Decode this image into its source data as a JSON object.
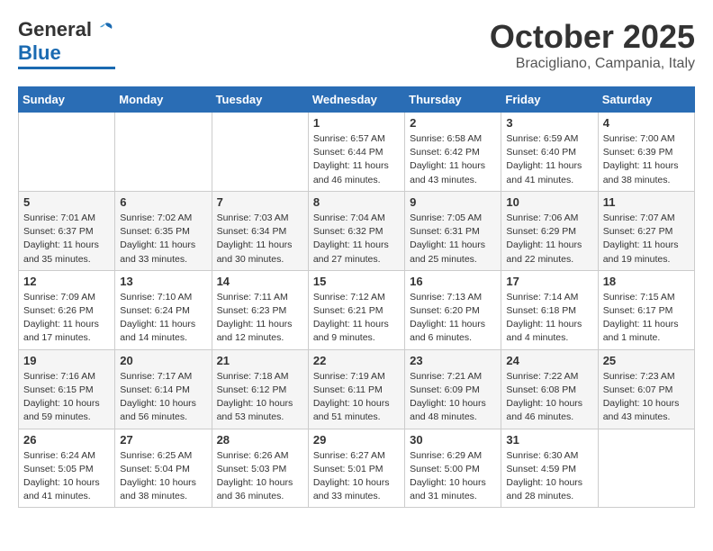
{
  "header": {
    "logo_general": "General",
    "logo_blue": "Blue",
    "month_title": "October 2025",
    "location": "Bracigliano, Campania, Italy"
  },
  "weekdays": [
    "Sunday",
    "Monday",
    "Tuesday",
    "Wednesday",
    "Thursday",
    "Friday",
    "Saturday"
  ],
  "weeks": [
    [
      {
        "day": "",
        "info": ""
      },
      {
        "day": "",
        "info": ""
      },
      {
        "day": "",
        "info": ""
      },
      {
        "day": "1",
        "info": "Sunrise: 6:57 AM\nSunset: 6:44 PM\nDaylight: 11 hours\nand 46 minutes."
      },
      {
        "day": "2",
        "info": "Sunrise: 6:58 AM\nSunset: 6:42 PM\nDaylight: 11 hours\nand 43 minutes."
      },
      {
        "day": "3",
        "info": "Sunrise: 6:59 AM\nSunset: 6:40 PM\nDaylight: 11 hours\nand 41 minutes."
      },
      {
        "day": "4",
        "info": "Sunrise: 7:00 AM\nSunset: 6:39 PM\nDaylight: 11 hours\nand 38 minutes."
      }
    ],
    [
      {
        "day": "5",
        "info": "Sunrise: 7:01 AM\nSunset: 6:37 PM\nDaylight: 11 hours\nand 35 minutes."
      },
      {
        "day": "6",
        "info": "Sunrise: 7:02 AM\nSunset: 6:35 PM\nDaylight: 11 hours\nand 33 minutes."
      },
      {
        "day": "7",
        "info": "Sunrise: 7:03 AM\nSunset: 6:34 PM\nDaylight: 11 hours\nand 30 minutes."
      },
      {
        "day": "8",
        "info": "Sunrise: 7:04 AM\nSunset: 6:32 PM\nDaylight: 11 hours\nand 27 minutes."
      },
      {
        "day": "9",
        "info": "Sunrise: 7:05 AM\nSunset: 6:31 PM\nDaylight: 11 hours\nand 25 minutes."
      },
      {
        "day": "10",
        "info": "Sunrise: 7:06 AM\nSunset: 6:29 PM\nDaylight: 11 hours\nand 22 minutes."
      },
      {
        "day": "11",
        "info": "Sunrise: 7:07 AM\nSunset: 6:27 PM\nDaylight: 11 hours\nand 19 minutes."
      }
    ],
    [
      {
        "day": "12",
        "info": "Sunrise: 7:09 AM\nSunset: 6:26 PM\nDaylight: 11 hours\nand 17 minutes."
      },
      {
        "day": "13",
        "info": "Sunrise: 7:10 AM\nSunset: 6:24 PM\nDaylight: 11 hours\nand 14 minutes."
      },
      {
        "day": "14",
        "info": "Sunrise: 7:11 AM\nSunset: 6:23 PM\nDaylight: 11 hours\nand 12 minutes."
      },
      {
        "day": "15",
        "info": "Sunrise: 7:12 AM\nSunset: 6:21 PM\nDaylight: 11 hours\nand 9 minutes."
      },
      {
        "day": "16",
        "info": "Sunrise: 7:13 AM\nSunset: 6:20 PM\nDaylight: 11 hours\nand 6 minutes."
      },
      {
        "day": "17",
        "info": "Sunrise: 7:14 AM\nSunset: 6:18 PM\nDaylight: 11 hours\nand 4 minutes."
      },
      {
        "day": "18",
        "info": "Sunrise: 7:15 AM\nSunset: 6:17 PM\nDaylight: 11 hours\nand 1 minute."
      }
    ],
    [
      {
        "day": "19",
        "info": "Sunrise: 7:16 AM\nSunset: 6:15 PM\nDaylight: 10 hours\nand 59 minutes."
      },
      {
        "day": "20",
        "info": "Sunrise: 7:17 AM\nSunset: 6:14 PM\nDaylight: 10 hours\nand 56 minutes."
      },
      {
        "day": "21",
        "info": "Sunrise: 7:18 AM\nSunset: 6:12 PM\nDaylight: 10 hours\nand 53 minutes."
      },
      {
        "day": "22",
        "info": "Sunrise: 7:19 AM\nSunset: 6:11 PM\nDaylight: 10 hours\nand 51 minutes."
      },
      {
        "day": "23",
        "info": "Sunrise: 7:21 AM\nSunset: 6:09 PM\nDaylight: 10 hours\nand 48 minutes."
      },
      {
        "day": "24",
        "info": "Sunrise: 7:22 AM\nSunset: 6:08 PM\nDaylight: 10 hours\nand 46 minutes."
      },
      {
        "day": "25",
        "info": "Sunrise: 7:23 AM\nSunset: 6:07 PM\nDaylight: 10 hours\nand 43 minutes."
      }
    ],
    [
      {
        "day": "26",
        "info": "Sunrise: 6:24 AM\nSunset: 5:05 PM\nDaylight: 10 hours\nand 41 minutes."
      },
      {
        "day": "27",
        "info": "Sunrise: 6:25 AM\nSunset: 5:04 PM\nDaylight: 10 hours\nand 38 minutes."
      },
      {
        "day": "28",
        "info": "Sunrise: 6:26 AM\nSunset: 5:03 PM\nDaylight: 10 hours\nand 36 minutes."
      },
      {
        "day": "29",
        "info": "Sunrise: 6:27 AM\nSunset: 5:01 PM\nDaylight: 10 hours\nand 33 minutes."
      },
      {
        "day": "30",
        "info": "Sunrise: 6:29 AM\nSunset: 5:00 PM\nDaylight: 10 hours\nand 31 minutes."
      },
      {
        "day": "31",
        "info": "Sunrise: 6:30 AM\nSunset: 4:59 PM\nDaylight: 10 hours\nand 28 minutes."
      },
      {
        "day": "",
        "info": ""
      }
    ]
  ]
}
